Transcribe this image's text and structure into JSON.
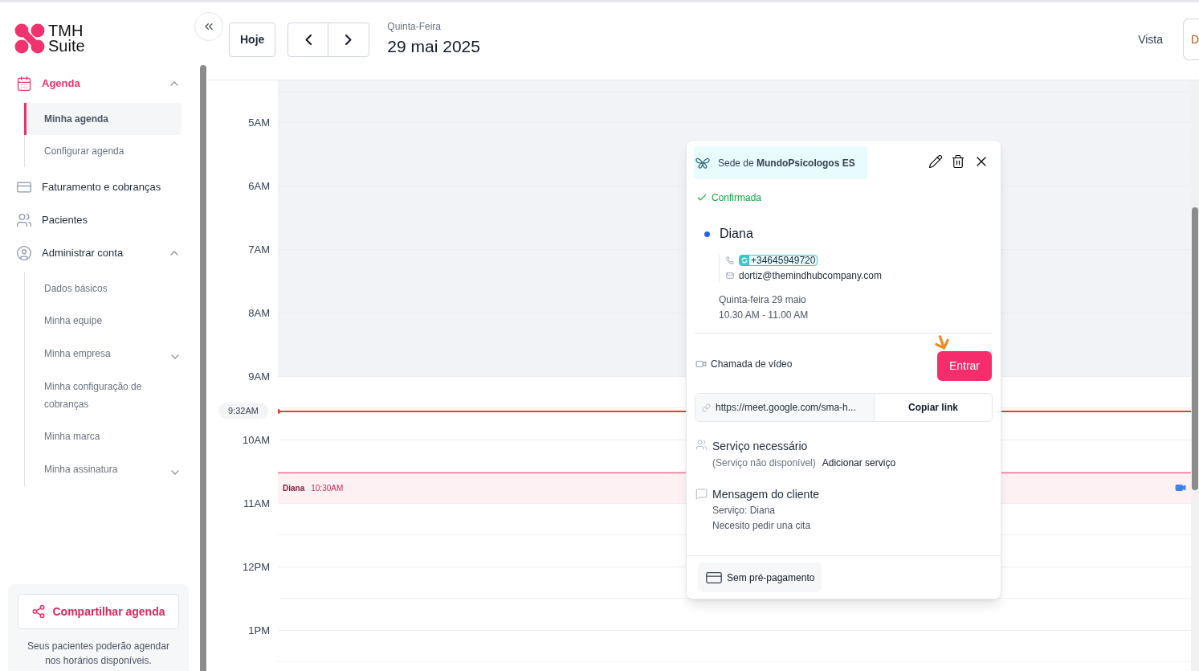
{
  "logo": {
    "line_1": "TMH",
    "line_2": "Suite"
  },
  "sidebar": {
    "items": [
      {
        "label": "Agenda",
        "expanded": true,
        "selected": true,
        "children": [
          {
            "label": "Minha agenda",
            "selected": true,
            "has_submenu": false
          },
          {
            "label": "Configurar agenda",
            "selected": false,
            "has_submenu": false
          }
        ]
      },
      {
        "label": "Faturamento e cobranças",
        "selected": false
      },
      {
        "label": "Pacientes",
        "selected": false
      },
      {
        "label": "Administrar conta",
        "expanded": true,
        "selected": false,
        "children": [
          {
            "label": "Dados básicos",
            "selected": false,
            "has_submenu": false
          },
          {
            "label": "Minha equipe",
            "selected": false,
            "has_submenu": false
          },
          {
            "label": "Minha empresa",
            "selected": false,
            "has_submenu": true
          },
          {
            "label": "Minha configuração de cobranças",
            "selected": false,
            "has_submenu": false
          },
          {
            "label": "Minha marca",
            "selected": false,
            "has_submenu": false
          },
          {
            "label": "Minha assinatura",
            "selected": false,
            "has_submenu": true
          }
        ]
      }
    ],
    "share": {
      "button": "Compartilhar agenda",
      "note": "Seus pacientes poderão agendar nos horários disponíveis."
    }
  },
  "toolbar": {
    "today": "Hoje",
    "weekday": "Quinta-Feira",
    "date": "29 mai 2025",
    "view_label": "Vista",
    "view_value": "D"
  },
  "calendar": {
    "hours": [
      {
        "label": "5AM",
        "available": false
      },
      {
        "label": "6AM",
        "available": false
      },
      {
        "label": "7AM",
        "available": false
      },
      {
        "label": "8AM",
        "available": false
      },
      {
        "label": "9AM",
        "available": true
      },
      {
        "label": "10AM",
        "available": true
      },
      {
        "label": "11AM",
        "available": true
      },
      {
        "label": "12PM",
        "available": true
      },
      {
        "label": "1PM",
        "available": true
      }
    ],
    "now": {
      "label": "9:32AM"
    },
    "events": [
      {
        "name": "Diana",
        "time": "10:30AM",
        "video": true
      }
    ]
  },
  "popover": {
    "location_prefix": "Sede de ",
    "location": "MundoPsicologos ES",
    "status": "Confirmada",
    "client": "Diana",
    "phone": "+34645949720",
    "email": "dortiz@themindhubcompany.com",
    "date": "Quinta-feira 29 maio",
    "time": "10.30 AM - 11.00 AM",
    "video_label": "Chamada de vídeo",
    "join": "Entrar",
    "link": "https://meet.google.com/sma-h...",
    "copy": "Copiar link",
    "service_title": "Serviço necessário",
    "service_status": "(Serviço não disponível)",
    "add_service": "Adicionar serviço",
    "message_title": "Mensagem do cliente",
    "message_lines": [
      "Serviço: Diana",
      "Necesito pedir una cita"
    ],
    "payment": "Sem pré-pagamento"
  }
}
